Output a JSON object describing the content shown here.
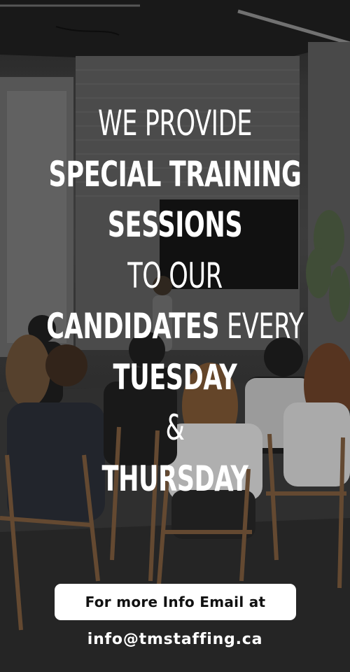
{
  "headline": {
    "line1": "WE PROVIDE",
    "line2": "SPECIAL TRAINING",
    "line3": "SESSIONS",
    "line4": "TO OUR",
    "line5_bold": "CANDIDATES",
    "line5_light": " EVERY",
    "line6": "TUESDAY",
    "line7": "&",
    "line8": "THURSDAY"
  },
  "cta": {
    "label": "For more Info Email at"
  },
  "contact": {
    "email": "info@tmstaffing.ca"
  },
  "colors": {
    "text": "#ffffff",
    "button_bg": "#ffffff",
    "button_text": "#111111"
  }
}
